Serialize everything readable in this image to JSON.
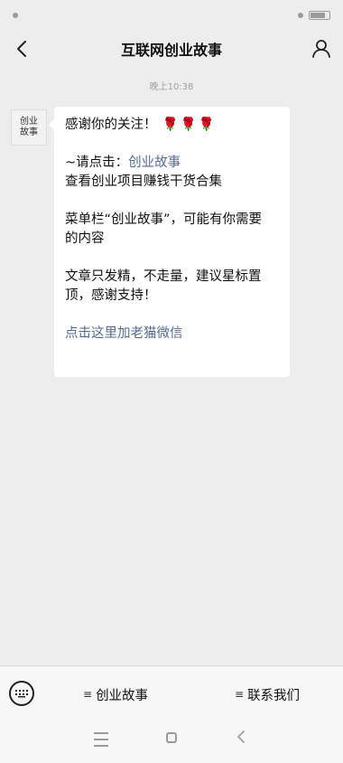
{
  "nav": {
    "title": "互联网创业故事"
  },
  "timestamp": "晚上10:38",
  "avatar": {
    "line1": "创业",
    "line2": "故事"
  },
  "message": {
    "line1": "感谢你的关注！",
    "roses": "🌹🌹🌹",
    "line2_prefix": "~请点击：",
    "line2_link": "创业故事",
    "line3": "查看创业项目赚钱干货合集",
    "line4": "菜单栏“创业故事”，可能有你需要",
    "line5": "的内容",
    "line6": "文章只发精，不走量，建议星标置",
    "line7": "顶，感谢支持！",
    "line8_link": "点击这里加老猫微信"
  },
  "bottom_menu": {
    "item1": "创业故事",
    "item2": "联系我们"
  },
  "icons": {
    "back": "back-chevron-icon",
    "profile": "profile-icon",
    "keyboard": "keyboard-icon",
    "menu": "menu-lines-icon"
  },
  "colors": {
    "background": "#ededed",
    "bubble": "#ffffff",
    "link": "#576b95"
  }
}
